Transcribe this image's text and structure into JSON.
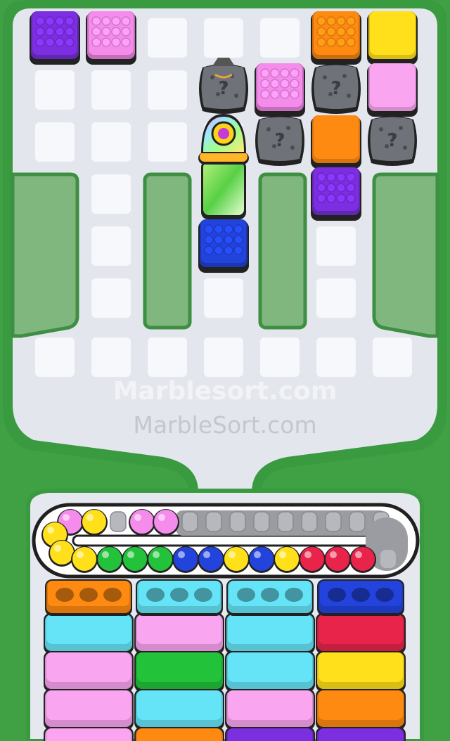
{
  "watermarks": {
    "primary": "Marblesort.com",
    "secondary": "MarbleSort.com"
  },
  "colors": {
    "purple": "#7b2fe0",
    "pink": "#f58bea",
    "orange": "#ff8a12",
    "yellow": "#ffe01a",
    "lightpink": "#f9a5f0",
    "blue": "#2244dd",
    "green": "#22c23a",
    "cyan": "#66e4f7",
    "red": "#e8244a",
    "stone": "#5e6167",
    "board": "#e5e7ee",
    "frame": "#3fa044"
  },
  "board": {
    "blocks": [
      {
        "type": "purple-block",
        "color": "purple",
        "col": 0,
        "row": 0
      },
      {
        "type": "pink-block",
        "color": "pink",
        "col": 1,
        "row": 0
      },
      {
        "type": "orange-block",
        "color": "orange",
        "col": 5,
        "row": 0
      },
      {
        "type": "yellow-block",
        "color": "yellow",
        "col": 6,
        "row": 0
      },
      {
        "type": "stone-bag-block",
        "color": "stone",
        "col": 3,
        "row": 1
      },
      {
        "type": "pink-block",
        "color": "pink",
        "col": 4,
        "row": 1
      },
      {
        "type": "stone-block",
        "color": "stone",
        "col": 5,
        "row": 1
      },
      {
        "type": "lightpink-block",
        "color": "lightpink",
        "col": 6,
        "row": 1
      },
      {
        "type": "stone-block",
        "color": "stone",
        "col": 4,
        "row": 2
      },
      {
        "type": "orange-block",
        "color": "orange",
        "col": 5,
        "row": 2
      },
      {
        "type": "stone-block",
        "color": "stone",
        "col": 6,
        "row": 2
      },
      {
        "type": "purple-block",
        "color": "purple",
        "col": 5,
        "row": 3
      },
      {
        "type": "blue-block",
        "color": "blue",
        "col": 3,
        "row": 4
      }
    ],
    "special": {
      "type": "rainbow-capsule",
      "col": 3,
      "row_start": 2,
      "row_end": 3
    }
  },
  "conveyor": {
    "row_top": [
      "pink",
      "yellow",
      "empty",
      "pink",
      "pink",
      "empty",
      "empty",
      "empty",
      "empty",
      "empty",
      "empty",
      "empty",
      "empty",
      "empty"
    ],
    "left_curve": [
      "yellow",
      "yellow"
    ],
    "row_bottom": [
      "yellow",
      "green",
      "green",
      "green",
      "blue",
      "blue",
      "yellow",
      "blue",
      "yellow",
      "red",
      "red",
      "red",
      "empty"
    ]
  },
  "trays": [
    {
      "cap": "orange",
      "stack": [
        "cyan",
        "lightpink",
        "lightpink",
        "lightpink"
      ]
    },
    {
      "cap": "cyan",
      "stack": [
        "lightpink",
        "green",
        "cyan",
        "orange"
      ]
    },
    {
      "cap": "cyan",
      "stack": [
        "cyan",
        "cyan",
        "lightpink",
        "purple"
      ]
    },
    {
      "cap": "blue",
      "stack": [
        "red",
        "yellow",
        "orange",
        "purple"
      ]
    }
  ]
}
